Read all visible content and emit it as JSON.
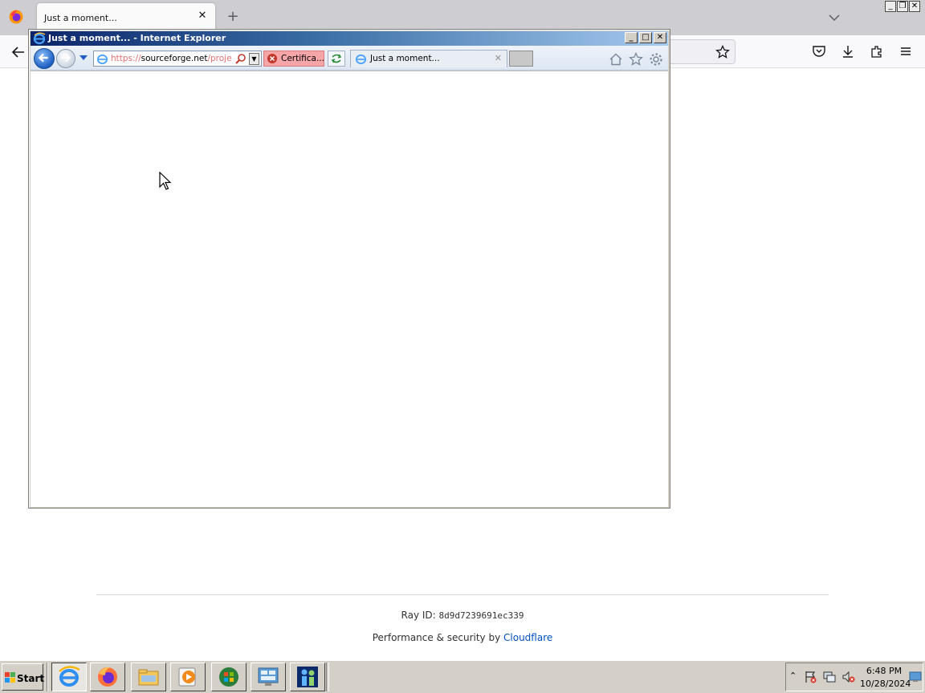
{
  "firefox": {
    "tab_title": "Just a moment...",
    "tab_close": "✕",
    "new_tab": "+"
  },
  "page": {
    "ray_label": "Ray ID: ",
    "ray_value": "8d9d7239691ec339",
    "perf_prefix": "Performance & security by ",
    "perf_link": "Cloudflare"
  },
  "ie": {
    "window_title": "Just a moment... - Internet Explorer",
    "url_scheme": "https://",
    "url_host": "sourceforge.net",
    "url_path": "/projec",
    "cert_label": "Certifica...",
    "tab_title": "Just a moment...",
    "tab_close": "✕"
  },
  "taskbar": {
    "start_label": "Start",
    "time": "6:48 PM",
    "date": "10/28/2024",
    "tray_expand": "⌃"
  },
  "colors": {
    "ie_title_gradient_start": "#0a246a",
    "ie_title_gradient_end": "#a6caf0",
    "cert_error_bg": "#f6a5a8",
    "cloudflare_link": "#0051c3",
    "taskbar": "#d4d0c8"
  },
  "icons": {
    "ie_controls": [
      "minimize-icon",
      "maximize-icon",
      "close-icon"
    ],
    "ie_toolbar": [
      "back-arrow-icon",
      "forward-arrow-icon",
      "home-icon",
      "favorites-star-icon",
      "tools-gear-icon"
    ],
    "taskbar_apps": [
      "internet-explorer-icon",
      "firefox-icon",
      "file-explorer-icon",
      "media-player-icon",
      "windows-logo-icon",
      "control-panel-icon",
      "users-icon"
    ]
  }
}
